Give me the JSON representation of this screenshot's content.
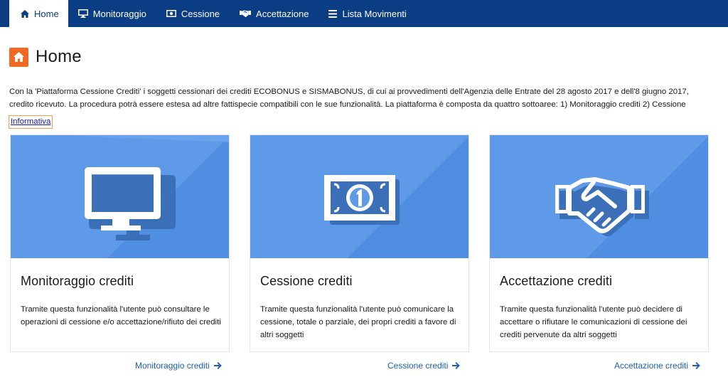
{
  "nav": {
    "items": [
      {
        "label": "Home",
        "icon": "home-icon"
      },
      {
        "label": "Monitoraggio",
        "icon": "monitor-icon"
      },
      {
        "label": "Cessione",
        "icon": "banknote-icon"
      },
      {
        "label": "Accettazione",
        "icon": "handshake-icon"
      },
      {
        "label": "Lista Movimenti",
        "icon": "list-icon"
      }
    ]
  },
  "header": {
    "title": "Home"
  },
  "intro": {
    "line1": "Con la 'Piattaforma Cessione Crediti' i soggetti cessionari dei crediti ECOBONUS e SISMABONUS, di cui ai provvedimenti dell'Agenzia delle Entrate del 28 agosto 2017 e dell'8 giugno 2017,",
    "line2": "credito ricevuto. La procedura potrà essere estesa ad altre fattispecie compatibili con le sue funzionalità. La piattaforma è composta da quattro sottoaree: 1) Monitoraggio crediti 2) Cessione",
    "link": "Informativa"
  },
  "cards": [
    {
      "title": "Monitoraggio crediti",
      "text": "Tramite questa funzionalità l'utente può consultare le operazioni di cessione e/o accettazione/rifiuto dei crediti",
      "link": "Monitoraggio crediti"
    },
    {
      "title": "Cessione crediti",
      "text": "Tramite questa funzionalità l'utente può comunicare la cessione, totale o parziale, dei propri crediti a favore di altri soggetti",
      "link": "Cessione crediti"
    },
    {
      "title": "Accettazione crediti",
      "text": "Tramite questa funzionalità l'utente può decidere di accettare o rifiutare le comunicazioni di cessione dei crediti pervenute da altri soggetti",
      "link": "Accettazione crediti"
    }
  ],
  "colors": {
    "nav_bg": "#0a3d84",
    "accent_orange": "#f26a21",
    "card_image_bg": "#5f9ae8",
    "link_blue": "#1f5fb8"
  }
}
